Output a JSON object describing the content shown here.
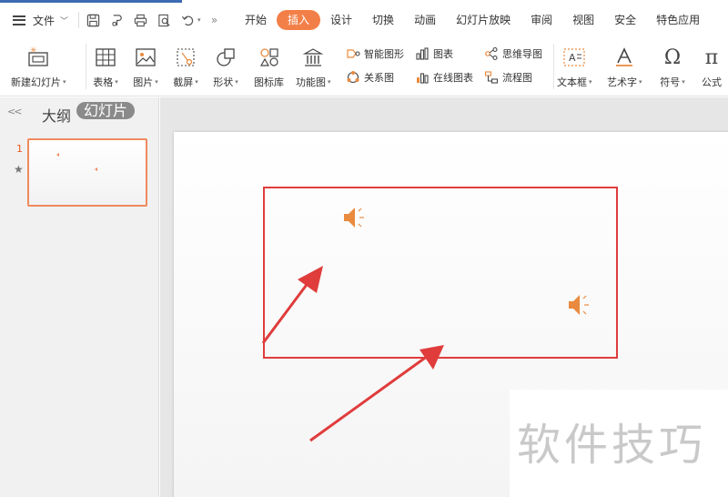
{
  "menubar": {
    "file_label": "文件",
    "tabs": [
      {
        "label": "开始",
        "active": false
      },
      {
        "label": "插入",
        "active": true
      },
      {
        "label": "设计",
        "active": false
      },
      {
        "label": "切换",
        "active": false
      },
      {
        "label": "动画",
        "active": false
      },
      {
        "label": "幻灯片放映",
        "active": false
      },
      {
        "label": "审阅",
        "active": false
      },
      {
        "label": "视图",
        "active": false
      },
      {
        "label": "安全",
        "active": false
      },
      {
        "label": "特色应用",
        "active": false
      }
    ],
    "quick_access_icons": [
      "save-icon",
      "format-painter-icon",
      "print-icon",
      "print-preview-icon",
      "undo-icon",
      "more-icon"
    ]
  },
  "ribbon": {
    "new_slide": "新建幻灯片",
    "table": "表格",
    "picture": "图片",
    "screenshot": "截屏",
    "shape": "形状",
    "icon_library": "图标库",
    "function_chart": "功能图",
    "smart_art": "智能图形",
    "relation_chart": "关系图",
    "chart": "图表",
    "online_chart": "在线图表",
    "mind_map": "思维导图",
    "flowchart": "流程图",
    "textbox": "文本框",
    "word_art": "艺术字",
    "symbol": "符号",
    "formula": "公式"
  },
  "left_pane": {
    "tab_outline": "大纲",
    "tab_slides": "幻灯片",
    "slide_number": "1"
  },
  "slide": {
    "audio_icons": [
      "speaker-icon",
      "speaker-icon"
    ]
  },
  "watermark": "软件技巧",
  "colors": {
    "accent": "#f37f48",
    "annotation_red": "#e03c3c",
    "speaker_orange": "#e98a3f"
  }
}
